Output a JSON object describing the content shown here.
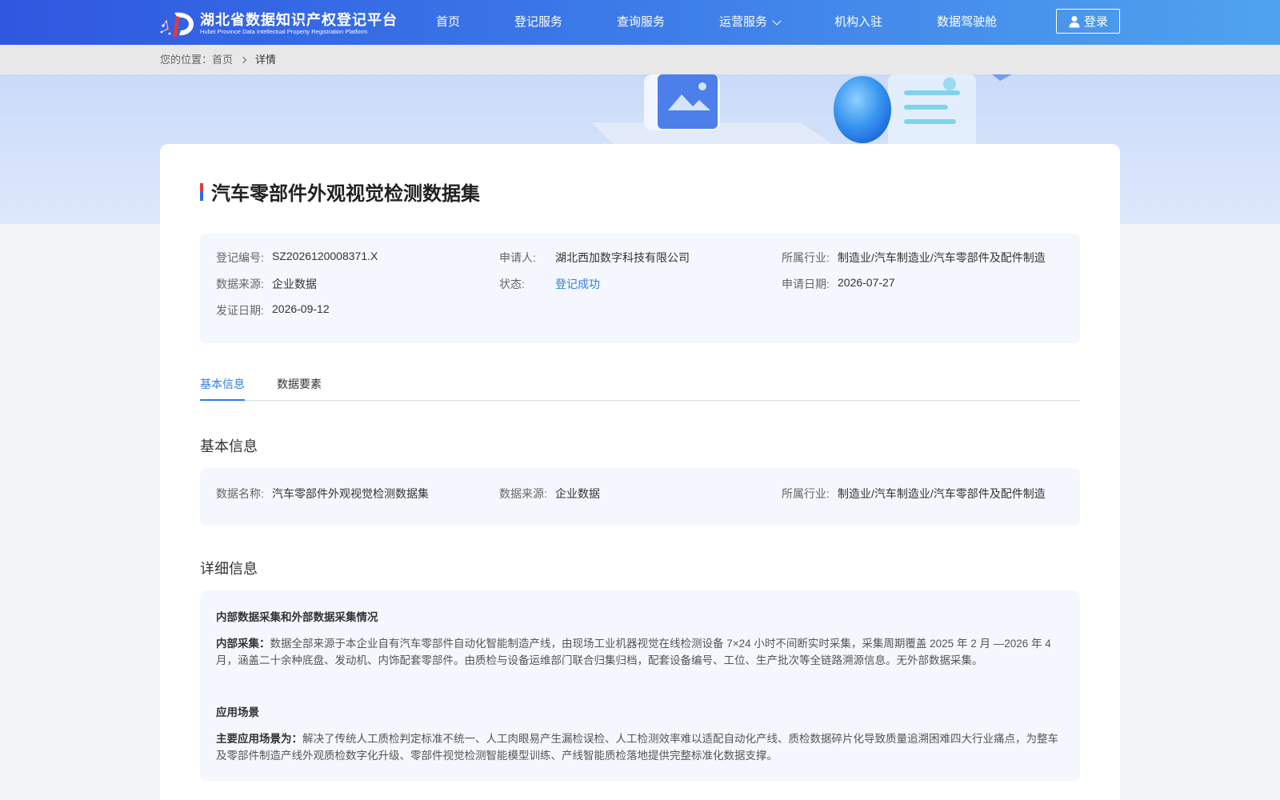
{
  "header": {
    "logo_cn": "湖北省数据知识产权登记平台",
    "logo_en": "Hubei Province Data Intellectual Property Registration Platform",
    "nav": [
      {
        "label": "首页"
      },
      {
        "label": "登记服务"
      },
      {
        "label": "查询服务"
      },
      {
        "label": "运营服务"
      },
      {
        "label": "机构入驻"
      },
      {
        "label": "数据驾驶舱"
      }
    ],
    "login_label": "登录"
  },
  "breadcrumb": {
    "prefix": "您的位置：",
    "home": "首页",
    "current": "详情"
  },
  "detail": {
    "title": "汽车零部件外观视觉检测数据集",
    "summary": {
      "reg_no_label": "登记编号:",
      "reg_no": "SZ2026120008371.X",
      "applicant_label": "申请人:",
      "applicant": "湖北西加数字科技有限公司",
      "industry_label": "所属行业:",
      "industry": "制造业/汽车制造业/汽车零部件及配件制造",
      "source_label": "数据来源:",
      "source": "企业数据",
      "status_label": "状态:",
      "status": "登记成功",
      "apply_date_label": "申请日期:",
      "apply_date": "2026-07-27",
      "issue_date_label": "发证日期:",
      "issue_date": "2026-09-12"
    },
    "tabs": [
      {
        "label": "基本信息"
      },
      {
        "label": "数据要素"
      }
    ],
    "basic": {
      "section_title": "基本信息",
      "name_label": "数据名称:",
      "name": "汽车零部件外观视觉检测数据集",
      "source_label": "数据来源:",
      "source": "企业数据",
      "industry_label": "所属行业:",
      "industry": "制造业/汽车制造业/汽车零部件及配件制造"
    },
    "more": {
      "section_title": "详细信息",
      "collection_head": "内部数据采集和外部数据采集情况",
      "internal_label": "内部采集：",
      "internal_text": "数据全部来源于本企业自有汽车零部件自动化智能制造产线，由现场工业机器视觉在线检测设备 7×24 小时不间断实时采集，采集周期覆盖 2025 年 2 月 —2026 年 4 月，涵盖二十余种底盘、发动机、内饰配套零部件。由质检与设备运维部门联合归集归档，配套设备编号、工位、生产批次等全链路溯源信息。无外部数据采集。",
      "scene_head": "应用场景",
      "scene_label": "主要应用场景为：",
      "scene_text": "解决了传统人工质检判定标准不统一、人工肉眼易产生漏检误检、人工检测效率难以适配自动化产线、质检数据碎片化导致质量追溯困难四大行业痛点，为整车及零部件制造产线外观质检数字化升级、零部件视觉检测智能模型训练、产线智能质检落地提供完整标准化数据支撑。"
    }
  }
}
